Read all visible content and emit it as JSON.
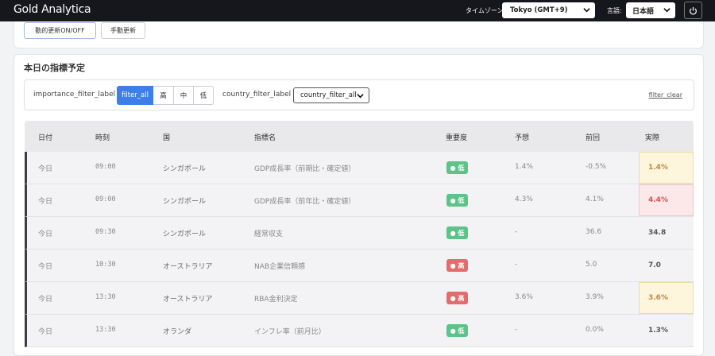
{
  "topbar": {
    "brand": "Gold Analytica",
    "timezone_label": "タイムゾーン:",
    "timezone_value": "Tokyo (GMT+9)",
    "language_label": "言語:",
    "language_value": "日本語",
    "power_icon": "power-icon",
    "chevron_icon": "chevron-down-icon"
  },
  "controls": {
    "auto_update": "動的更新ON/OFF",
    "manual_update": "手動更新"
  },
  "section": {
    "title": "本日の指標予定"
  },
  "filters": {
    "importance_label": "importance_filter_label",
    "importance_options": [
      "filter_all",
      "高",
      "中",
      "低"
    ],
    "importance_active": "filter_all",
    "country_label": "country_filter_label",
    "country_value": "country_filter_all",
    "clear": "filter_clear"
  },
  "table": {
    "headers": [
      "日付",
      "時刻",
      "国",
      "指標名",
      "重要度",
      "予想",
      "前回",
      "実際"
    ],
    "rows": [
      {
        "date": "今日",
        "time": "09:00",
        "country": "シンガポール",
        "name": "GDP成長率（前期比・確定値）",
        "importance": "● 低",
        "importance_level": "low",
        "forecast": "1.4%",
        "previous": "-0.5%",
        "actual": "1.4%",
        "actual_style": "gold"
      },
      {
        "date": "今日",
        "time": "09:00",
        "country": "シンガポール",
        "name": "GDP成長率（前年比・確定値）",
        "importance": "● 低",
        "importance_level": "low",
        "forecast": "4.3%",
        "previous": "4.1%",
        "actual": "4.4%",
        "actual_style": "red"
      },
      {
        "date": "今日",
        "time": "09:30",
        "country": "シンガポール",
        "name": "経常収支",
        "importance": "● 低",
        "importance_level": "low",
        "forecast": "-",
        "previous": "36.6",
        "actual": "34.8",
        "actual_style": "plain"
      },
      {
        "date": "今日",
        "time": "10:30",
        "country": "オーストラリア",
        "name": "NAB企業信頼感",
        "importance": "● 高",
        "importance_level": "high",
        "forecast": "-",
        "previous": "5.0",
        "actual": "7.0",
        "actual_style": "plain"
      },
      {
        "date": "今日",
        "time": "13:30",
        "country": "オーストラリア",
        "name": "RBA金利決定",
        "importance": "● 高",
        "importance_level": "high",
        "forecast": "3.6%",
        "previous": "3.9%",
        "actual": "3.6%",
        "actual_style": "gold"
      },
      {
        "date": "今日",
        "time": "13:30",
        "country": "オランダ",
        "name": "インフレ率（前月比）",
        "importance": "● 低",
        "importance_level": "low",
        "forecast": "-",
        "previous": "0.0%",
        "actual": "1.3%",
        "actual_style": "plain"
      }
    ]
  },
  "colors": {
    "topbar_bg": "#16161d",
    "accent": "#3d7ee8",
    "badge_low": "#5cc48a",
    "badge_high": "#e46c6c",
    "actual_gold": "#c9853a",
    "actual_red": "#d9534f"
  }
}
